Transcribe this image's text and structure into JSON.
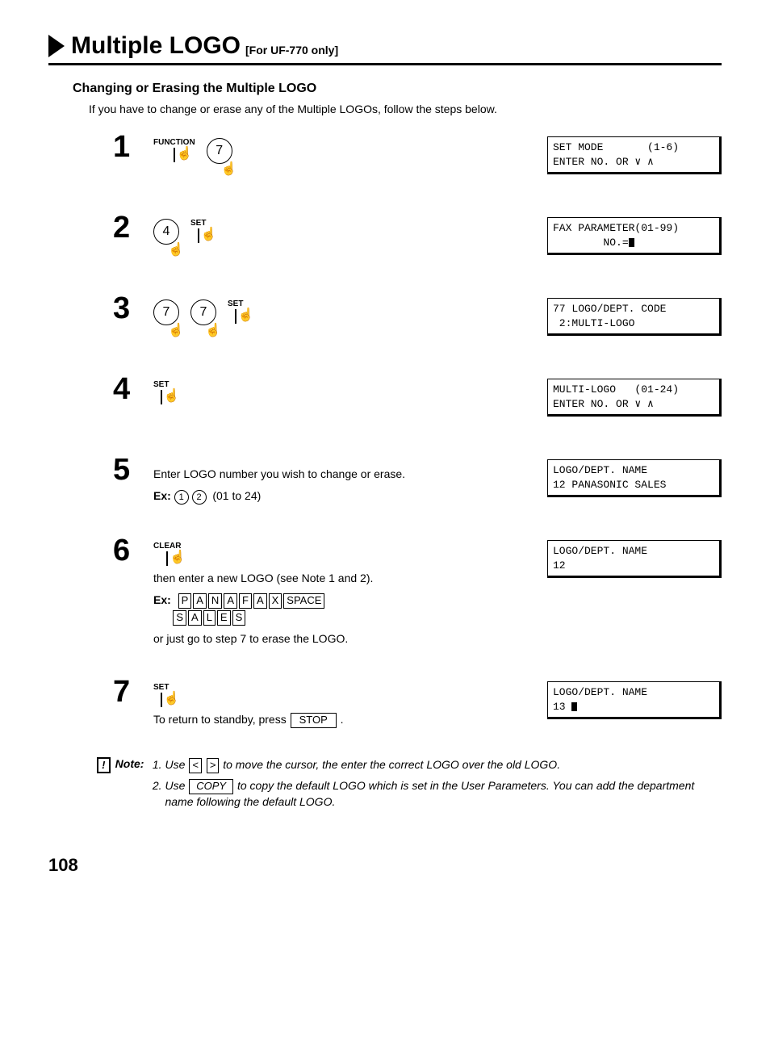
{
  "title": {
    "main": "Multiple LOGO",
    "sub": "[For UF-770 only]"
  },
  "heading": "Changing or Erasing the Multiple LOGO",
  "intro": "If you have to change or erase any of the Multiple LOGOs, follow the steps below.",
  "steps": {
    "s1": {
      "num": "1",
      "btn_function": "FUNCTION",
      "key1": "7",
      "lcd": "SET MODE       (1-6)\nENTER NO. OR ∨ ∧"
    },
    "s2": {
      "num": "2",
      "key1": "4",
      "btn_set": "SET",
      "lcd": "FAX PARAMETER(01-99)\n        NO.="
    },
    "s3": {
      "num": "3",
      "key1": "7",
      "key2": "7",
      "btn_set": "SET",
      "lcd": "77 LOGO/DEPT. CODE\n 2:MULTI-LOGO"
    },
    "s4": {
      "num": "4",
      "btn_set": "SET",
      "lcd": "MULTI-LOGO   (01-24)\nENTER NO. OR ∨ ∧"
    },
    "s5": {
      "num": "5",
      "instr1": "Enter LOGO number you wish to change or erase.",
      "ex_label": "Ex:",
      "ex_k1": "1",
      "ex_k2": "2",
      "ex_range": "(01 to 24)",
      "lcd": "LOGO/DEPT. NAME\n12 PANASONIC SALES"
    },
    "s6": {
      "num": "6",
      "btn_clear": "CLEAR",
      "instr1": "then enter a new LOGO (see Note 1 and 2).",
      "ex_label": "Ex:",
      "ex_keys1": [
        "P",
        "A",
        "N",
        "A",
        "F",
        "A",
        "X",
        "SPACE"
      ],
      "ex_keys2": [
        "S",
        "A",
        "L",
        "E",
        "S"
      ],
      "instr2": "or just go to step 7 to erase the LOGO.",
      "lcd": "LOGO/DEPT. NAME\n12"
    },
    "s7": {
      "num": "7",
      "btn_set": "SET",
      "instr1_a": "To return to standby, press ",
      "instr1_key": "STOP",
      "instr1_b": " .",
      "lcd": "LOGO/DEPT. NAME\n13 "
    }
  },
  "notes": {
    "icon": "!",
    "label": "Note:",
    "n1_a": "Use ",
    "n1_k1": "<",
    "n1_k2": ">",
    "n1_b": " to move the cursor, the enter the correct LOGO over the old LOGO.",
    "n2_a": "Use ",
    "n2_key": "COPY",
    "n2_b": " to copy the default LOGO which is set in the User Parameters.  You can add the department name following the default LOGO."
  },
  "page": "108"
}
